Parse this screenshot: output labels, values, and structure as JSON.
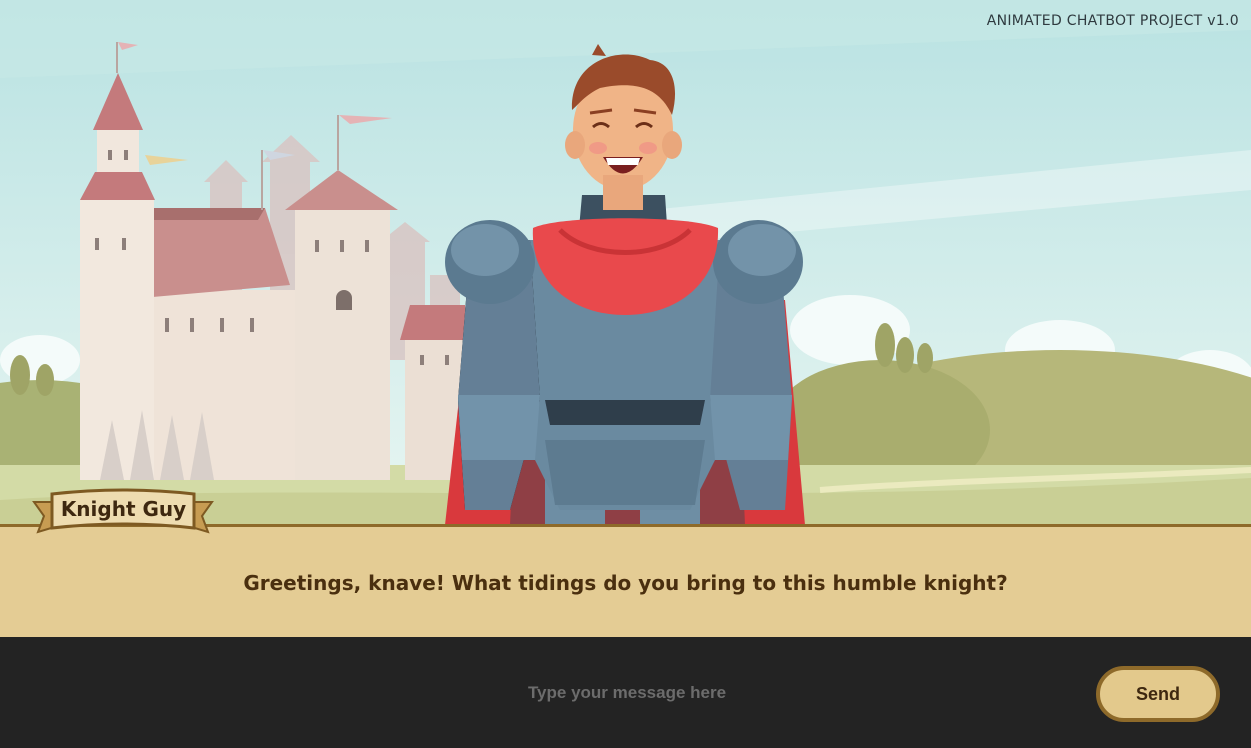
{
  "header": {
    "project_title": "ANIMATED CHATBOT PROJECT v1.0"
  },
  "character": {
    "name": "Knight Guy"
  },
  "dialogue": {
    "text": "Greetings, knave! What tidings do you bring to this humble knight?"
  },
  "input": {
    "placeholder": "Type your message here",
    "value": ""
  },
  "send_button": {
    "label": "Send"
  },
  "colors": {
    "sky": "#cdeceb",
    "dialogue_bg": "#e4cc94",
    "dialogue_border": "#8e6a2a",
    "bottom_bar": "#232323",
    "button_bg": "#e3c98c",
    "cape": "#e9494c",
    "armor": "#5f7c91"
  }
}
